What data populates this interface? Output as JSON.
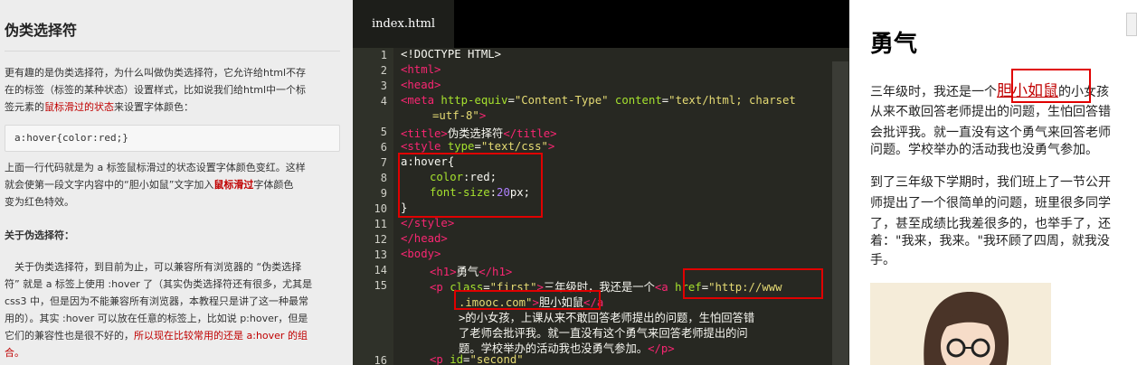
{
  "lesson": {
    "title": "伪类选择符",
    "intro_a": "更有趣的是伪类选择符，为什么叫做伪类选择符，它允许给html不存",
    "intro_b": "在的标签（标签的某种状态）设置样式，比如说我们给html中一个标",
    "intro_c_pre": "签元素的",
    "intro_c_red": "鼠标滑过的状态",
    "intro_c_post": "来设置字体颜色：",
    "code": "a:hover{color:red;}",
    "desc_a": "上面一行代码就是为 a 标签鼠标滑过的状态设置字体颜色变红。这样",
    "desc_b": "就会使第一段文字内容中的“胆小如鼠”文字加入",
    "desc_b_red": "鼠标滑过",
    "desc_b_post": "字体颜色",
    "desc_c": "变为红色特效。",
    "about": "关于伪选择符：",
    "body_a": "　关于伪类选择符，到目前为止，可以兼容所有浏览器的 “伪类选择",
    "body_b": "符” 就是 a 标签上使用 :hover 了（其实伪类选择符还有很多，尤其是",
    "body_c": "css3 中，但是因为不能兼容所有浏览器，本教程只是讲了这一种最常",
    "body_d": "用的）。其实 :hover 可以放在任意的标签上，比如说 p:hover，但是",
    "body_e_pre": "它们的兼容性也是很不好的，",
    "body_e_red": "所以现在比较常用的还是 a:hover 的组",
    "body_f_red": "合。"
  },
  "editor": {
    "tab": "index.html",
    "line_numbers": [
      "1",
      "2",
      "3",
      "4",
      "",
      "5",
      "6",
      "7",
      "8",
      "9",
      "10",
      "11",
      "12",
      "13",
      "14",
      "15",
      "",
      "",
      "",
      "",
      "16"
    ],
    "l1": "<!DOCTYPE HTML>",
    "l2": "<html>",
    "l3": "<head>",
    "l4_tag": "<meta ",
    "l4_attr1": "http-equiv",
    "l4_eq1": "=",
    "l4_val1": "\"Content-Type\"",
    "l4_attr2": " content",
    "l4_eq2": "=",
    "l4_val2": "\"text/html; charset",
    "l4b_val": "=utf-8\"",
    "l4b_close": ">",
    "l5_open": "<title>",
    "l5_text": "伪类选择符",
    "l5_close": "</title>",
    "l6_tag": "<style ",
    "l6_attr": "type",
    "l6_eq": "=",
    "l6_val": "\"text/css\"",
    "l6_close": ">",
    "l7": "a:hover{",
    "l8_prop": "color",
    "l8_rest": ":red;",
    "l9_prop": "font-size",
    "l9_colon": ":",
    "l9_num": "20",
    "l9_unit": "px;",
    "l10": "}",
    "l11": "</style>",
    "l12": "</head>",
    "l13": "<body>",
    "l14_open": "<h1>",
    "l14_text": "勇气",
    "l14_close": "</h1>",
    "l15_tag": "<p ",
    "l15_attr": "class",
    "l15_eq": "=",
    "l15_val": "\"first\"",
    "l15_gt": ">",
    "l15_text": "三年级时，我还是一个",
    "l15_a": "<a ",
    "l15_href": "href",
    "l15_heq": "=",
    "l15_hval": "\"http://www",
    "l15b_val": ".imooc.com\"",
    "l15b_gt": ">",
    "l15b_text": "胆小如鼠",
    "l15b_close": "</a",
    "l15c": ">的小女孩，上课从来不敢回答老师提出的问题，生怕回答错",
    "l15d": "了老师会批评我。就一直没有这个勇气来回答老师提出的问",
    "l15e_text": "题。学校举办的活动我也没勇气参加。",
    "l15e_close": "</p>",
    "l16_tag": "<p ",
    "l16_attr": "id",
    "l16_eq": "=",
    "l16_val": "\"second\""
  },
  "preview": {
    "heading": "勇气",
    "p1a_pre": "三年级时，我还是一个",
    "p1a_link": "胆小如鼠",
    "p1a_post": "的小女孩",
    "p1b": "从来不敢回答老师提出的问题，生怕回答错",
    "p1c": "会批评我。就一直没有这个勇气来回答老师",
    "p1d": "问题。学校举办的活动我也没勇气参加。",
    "p2a": "到了三年级下学期时，我们班上了一节公开",
    "p2b": "师提出了一个很简单的问题，班里很多同学",
    "p2c": "了，甚至成绩比我差很多的，也举手了，还",
    "p2d": "着：\"我来，我来。\"我环顾了四周，就我没",
    "p2e": "手。"
  }
}
